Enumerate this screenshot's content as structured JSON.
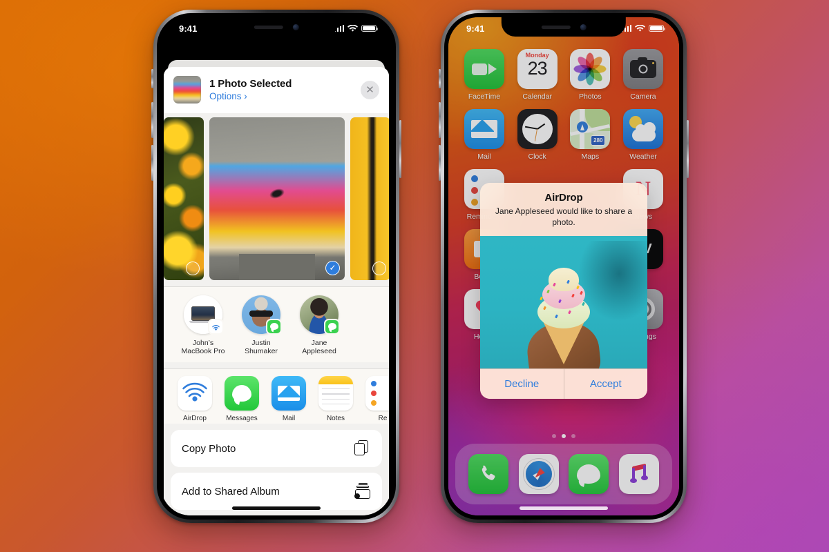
{
  "left_phone": {
    "status_bar": {
      "time": "9:41",
      "cellular": "signal-bars",
      "wifi": "wifi",
      "battery": "battery-full"
    },
    "share_sheet": {
      "title": "1 Photo Selected",
      "options_label": "Options ›",
      "close_label": "✕",
      "photos": [
        {
          "name": "flowers-photo",
          "selected": false
        },
        {
          "name": "graffiti-photo",
          "selected": true
        },
        {
          "name": "yellow-door-photo",
          "selected": false
        }
      ],
      "people": [
        {
          "name": "John’s\nMacBook Pro",
          "line1": "John’s",
          "line2": "MacBook Pro",
          "badge": "airdrop"
        },
        {
          "name": "Justin Shumaker",
          "line1": "Justin",
          "line2": "Shumaker",
          "badge": "messages"
        },
        {
          "name": "Jane Appleseed",
          "line1": "Jane",
          "line2": "Appleseed",
          "badge": "messages"
        }
      ],
      "apps": [
        {
          "label": "AirDrop"
        },
        {
          "label": "Messages"
        },
        {
          "label": "Mail"
        },
        {
          "label": "Notes"
        },
        {
          "label": "Re"
        }
      ],
      "actions": [
        {
          "label": "Copy Photo",
          "icon": "copy-icon"
        },
        {
          "label": "Add to Shared Album",
          "icon": "shared-album-icon"
        }
      ]
    }
  },
  "right_phone": {
    "status_bar": {
      "time": "9:41",
      "cellular": "signal-bars",
      "wifi": "wifi",
      "battery": "battery-full"
    },
    "home_screen": {
      "rows": [
        [
          {
            "label": "FaceTime"
          },
          {
            "label": "Calendar",
            "weekday": "Monday",
            "day": "23"
          },
          {
            "label": "Photos"
          },
          {
            "label": "Camera"
          }
        ],
        [
          {
            "label": "Mail"
          },
          {
            "label": "Clock"
          },
          {
            "label": "Maps",
            "shield": "280"
          },
          {
            "label": "Weather"
          }
        ],
        [
          {
            "label": "Reminders"
          },
          {
            "label": ""
          },
          {
            "label": ""
          },
          {
            "label": "News"
          }
        ],
        [
          {
            "label": "Books"
          },
          {
            "label": ""
          },
          {
            "label": ""
          },
          {
            "label": "TV"
          }
        ],
        [
          {
            "label": "Health"
          },
          {
            "label": ""
          },
          {
            "label": ""
          },
          {
            "label": "Settings"
          }
        ]
      ],
      "page_dots": 3,
      "active_page": 2,
      "dock": [
        {
          "label": "Phone"
        },
        {
          "label": "Safari"
        },
        {
          "label": "Messages"
        },
        {
          "label": "Music"
        }
      ]
    },
    "airdrop_alert": {
      "title": "AirDrop",
      "message": "Jane Appleseed would like to share a photo.",
      "decline_label": "Decline",
      "accept_label": "Accept",
      "photo": "ice-cream-cone-photo"
    }
  },
  "colors": {
    "accent_blue": "#2f7ddc",
    "imessage_green": "#3ad14f",
    "alert_bg": "#fdecde",
    "background_start": "#d96a06",
    "background_end": "#a84fb0"
  }
}
